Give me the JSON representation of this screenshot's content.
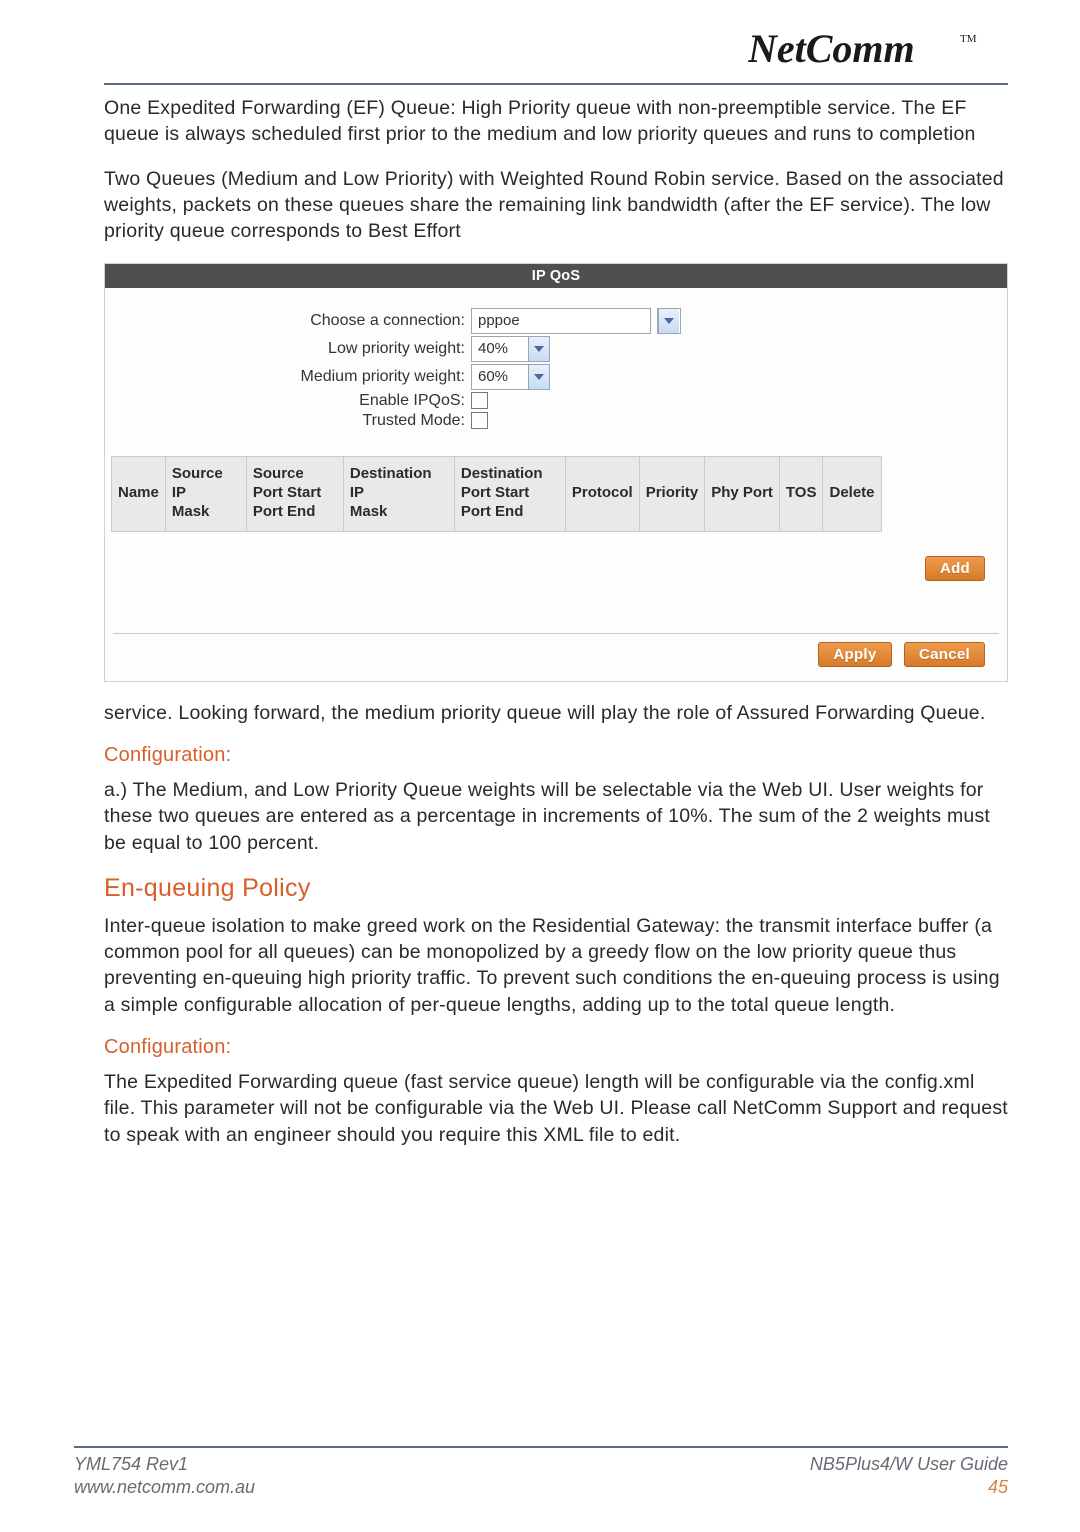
{
  "logo_text": "NetComm",
  "logo_tm": "TM",
  "intro_para_1": "One Expedited Forwarding (EF) Queue: High Priority queue with non-preemptible service. The EF queue is always scheduled first prior to the medium and low priority queues and runs to completion",
  "intro_para_2": "Two Queues (Medium and Low Priority) with Weighted Round Robin service. Based on the associated weights, packets on these queues share the remaining link bandwidth (after the EF service). The low priority queue corresponds to Best Effort",
  "panel": {
    "title": "IP QoS",
    "fields": {
      "connection_label": "Choose a connection:",
      "connection_value": "pppoe",
      "low_weight_label": "Low priority weight:",
      "low_weight_value": "40%",
      "med_weight_label": "Medium priority weight:",
      "med_weight_value": "60%",
      "enable_label": "Enable IPQoS:",
      "trusted_label": "Trusted Mode:"
    },
    "columns": {
      "c0": "Name",
      "c1": "Source IP Mask",
      "c2": "Source Port Start Port End",
      "c3": "Destination IP Mask",
      "c4": "Destination Port Start Port End",
      "c5": "Protocol",
      "c6": "Priority",
      "c7": "Phy Port",
      "c8": "TOS",
      "c9": "Delete"
    },
    "buttons": {
      "add": "Add",
      "apply": "Apply",
      "cancel": "Cancel"
    }
  },
  "after_panel_para": "service. Looking forward, the medium priority queue will play the role of Assured Forwarding Queue.",
  "config1_heading": "Configuration:",
  "config1_para": "a.) The Medium, and Low Priority Queue weights will be selectable via the Web UI. User weights for these two queues are entered as a percentage in increments of 10%. The sum of the 2 weights must be equal to 100 percent.",
  "enqueue_heading": "En-queuing Policy",
  "enqueue_para": "Inter-queue isolation to make greed work on the Residential Gateway: the transmit interface buffer (a common pool for all queues) can be monopolized by a greedy flow on the low priority queue thus preventing en-queuing high priority traffic. To prevent such conditions the en-queuing process is using a simple configurable allocation of per-queue lengths, adding up to the total queue length.",
  "config2_heading": "Configuration:",
  "config2_para": "The Expedited Forwarding queue (fast service queue) length will be configurable via the config.xml file. This parameter will not be configurable via the Web UI.  Please call NetComm Support and request to speak with an engineer should you require this XML file to edit.",
  "footer": {
    "rev": "YML754 Rev1",
    "guide": "NB5Plus4/W User Guide",
    "url": "www.netcomm.com.au",
    "page": "45"
  }
}
